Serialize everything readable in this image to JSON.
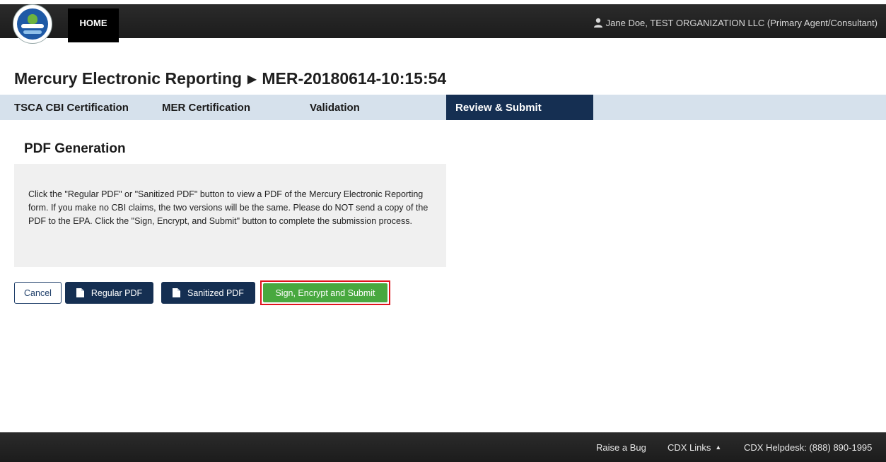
{
  "header": {
    "home_label": "HOME",
    "user_text": "Jane Doe, TEST ORGANIZATION LLC (Primary Agent/Consultant)"
  },
  "page": {
    "title_app": "Mercury Electronic Reporting",
    "title_separator": "▶",
    "title_id": "MER-20180614-10:15:54"
  },
  "steps": [
    {
      "label": "TSCA CBI Certification",
      "active": false
    },
    {
      "label": "MER Certification",
      "active": false
    },
    {
      "label": "Validation",
      "active": false
    },
    {
      "label": "Review & Submit",
      "active": true
    }
  ],
  "pdf_section": {
    "title": "PDF Generation",
    "instructions": "Click the \"Regular PDF\" or \"Sanitized PDF\" button to view a PDF of the Mercury Electronic Reporting form. If you make no CBI claims, the two versions will be the same. Please do NOT send a copy of the PDF to the EPA. Click the \"Sign, Encrypt, and Submit\" button to complete the submission process."
  },
  "buttons": {
    "cancel": "Cancel",
    "regular_pdf": "Regular PDF",
    "sanitized_pdf": "Sanitized PDF",
    "submit": "Sign, Encrypt and Submit"
  },
  "footer": {
    "raise_bug": "Raise a Bug",
    "cdx_links": "CDX Links",
    "helpdesk": "CDX Helpdesk: (888) 890-1995"
  },
  "colors": {
    "navy": "#152f52",
    "step_bar": "#d6e1ec",
    "submit_green": "#48a83f",
    "highlight_red": "#e0121d"
  }
}
